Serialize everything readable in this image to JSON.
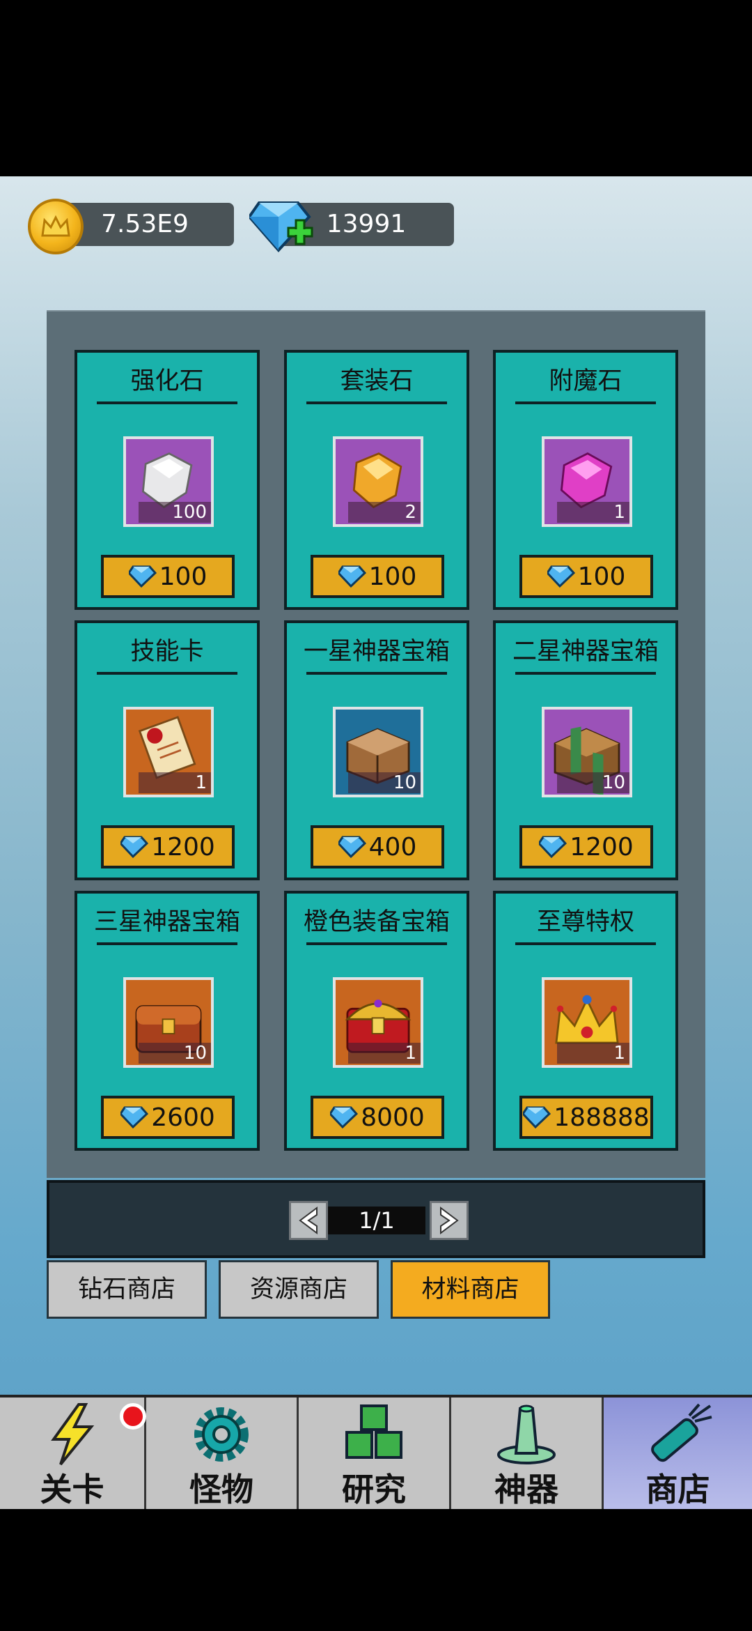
{
  "currency": {
    "gold": "7.53E9",
    "diamonds": "13991"
  },
  "colors": {
    "card_bg": "#1ab2ab",
    "price_bg": "#e5a81f",
    "active_tab": "#f4ab1f",
    "nav_active": "#b9bdea"
  },
  "items": [
    {
      "name": "强化石",
      "qty": "100",
      "price": "100",
      "icon": "white-gem-icon",
      "rarity": "purple"
    },
    {
      "name": "套装石",
      "qty": "2",
      "price": "100",
      "icon": "orange-gem-icon",
      "rarity": "purple"
    },
    {
      "name": "附魔石",
      "qty": "1",
      "price": "100",
      "icon": "magenta-gem-icon",
      "rarity": "purple"
    },
    {
      "name": "技能卡",
      "qty": "1",
      "price": "1200",
      "icon": "scroll-icon",
      "rarity": "orange"
    },
    {
      "name": "一星神器宝箱",
      "qty": "10",
      "price": "400",
      "icon": "wooden-chest-icon",
      "rarity": "blue"
    },
    {
      "name": "二星神器宝箱",
      "qty": "10",
      "price": "1200",
      "icon": "green-chest-icon",
      "rarity": "purple"
    },
    {
      "name": "三星神器宝箱",
      "qty": "10",
      "price": "2600",
      "icon": "red-chest-icon",
      "rarity": "orange"
    },
    {
      "name": "橙色装备宝箱",
      "qty": "1",
      "price": "8000",
      "icon": "gold-chest-icon",
      "rarity": "orange"
    },
    {
      "name": "至尊特权",
      "qty": "1",
      "price": "188888",
      "icon": "crown-icon",
      "rarity": "orange"
    }
  ],
  "pager": {
    "text": "1/1"
  },
  "tabs": [
    {
      "label": "钻石商店",
      "active": false
    },
    {
      "label": "资源商店",
      "active": false
    },
    {
      "label": "材料商店",
      "active": true
    }
  ],
  "nav": [
    {
      "label": "关卡",
      "icon": "lightning-icon"
    },
    {
      "label": "怪物",
      "icon": "gear-icon"
    },
    {
      "label": "研究",
      "icon": "blocks-icon"
    },
    {
      "label": "神器",
      "icon": "hat-icon"
    },
    {
      "label": "商店",
      "icon": "bottle-icon"
    }
  ]
}
